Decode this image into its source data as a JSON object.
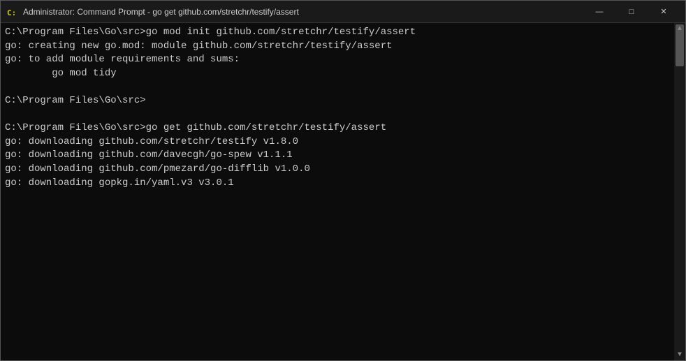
{
  "window": {
    "title": "Administrator: Command Prompt - go  get github.com/stretchr/testify/assert",
    "icon": "cmd-icon"
  },
  "controls": {
    "minimize": "—",
    "maximize": "□",
    "close": "✕"
  },
  "terminal": {
    "lines": [
      "C:\\Program Files\\Go\\src>go mod init github.com/stretchr/testify/assert",
      "go: creating new go.mod: module github.com/stretchr/testify/assert",
      "go: to add module requirements and sums:",
      "\tgo mod tidy",
      "",
      "C:\\Program Files\\Go\\src>",
      "",
      "C:\\Program Files\\Go\\src>go get github.com/stretchr/testify/assert",
      "go: downloading github.com/stretchr/testify v1.8.0",
      "go: downloading github.com/davecgh/go-spew v1.1.1",
      "go: downloading github.com/pmezard/go-difflib v1.0.0",
      "go: downloading gopkg.in/yaml.v3 v3.0.1",
      "",
      "",
      "",
      "",
      "",
      "",
      "",
      "",
      "",
      "",
      "",
      "",
      "",
      "",
      ""
    ]
  }
}
